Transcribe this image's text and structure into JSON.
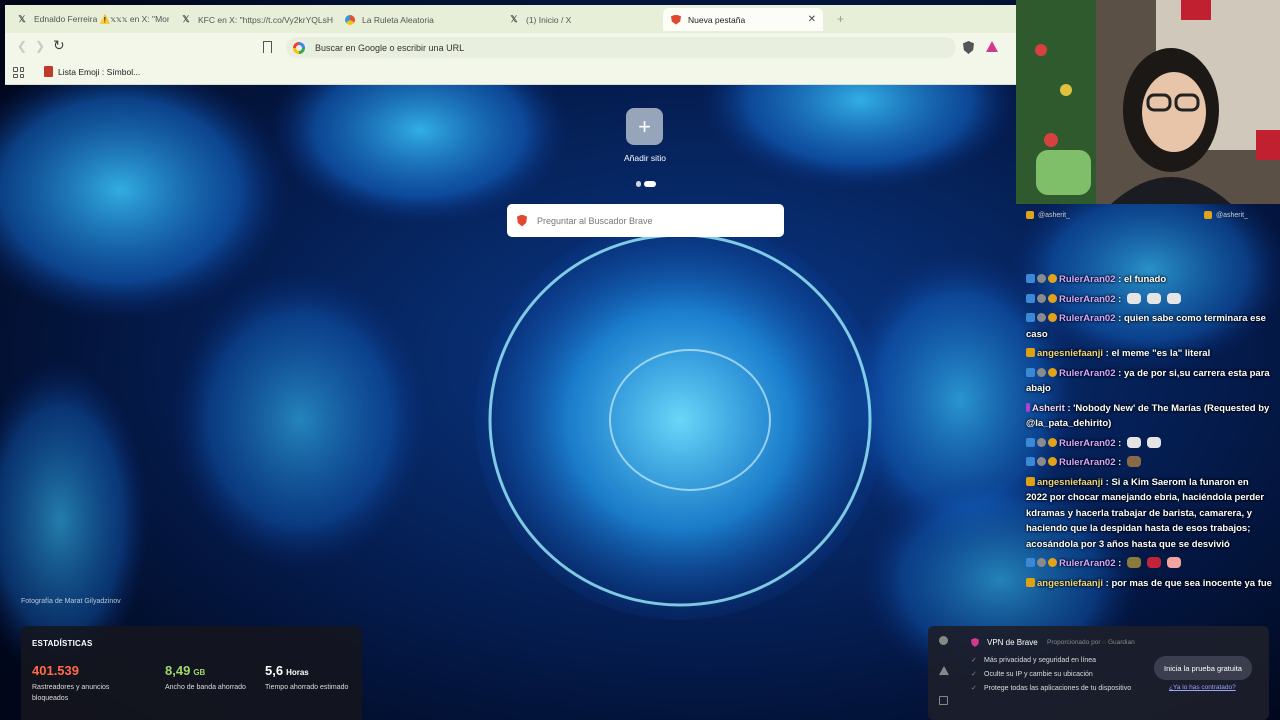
{
  "browser": {
    "tabs": [
      {
        "label": "Ednaldo Ferreira ⚠️𝕩𝕩𝕩 en X: \"Mon",
        "icon": "x-logo-icon",
        "active": false
      },
      {
        "label": "KFC en X: \"https://t.co/Vy2krYQLsH\"",
        "icon": "x-logo-icon",
        "active": false
      },
      {
        "label": "La Ruleta Aleatoria",
        "icon": "ruleta-icon",
        "active": false
      },
      {
        "label": "(1) Inicio / X",
        "icon": "x-logo-icon",
        "active": false
      },
      {
        "label": "Nueva pestaña",
        "icon": "brave-icon",
        "active": true
      }
    ],
    "close_glyph": "✕",
    "new_tab_glyph": "+",
    "back_glyph": "❮",
    "forward_glyph": "❯",
    "reload_glyph": "↻",
    "omnibox_placeholder": "Buscar en Google o escribir una URL",
    "bookmarks": [
      {
        "label": "Lista Emoji : Símbol..."
      }
    ]
  },
  "newtab": {
    "add_site_glyph": "+",
    "add_site_label": "Añadir sitio",
    "search_placeholder": "Preguntar al Buscador Brave",
    "photo_credit": "Fotografía de Marat Gilyadzinov",
    "stats": {
      "title": "ESTADÍSTICAS",
      "items": [
        {
          "value": "401.539",
          "unit": "",
          "desc": "Rastreadores y anuncios bloqueados",
          "color": "#ff6b4a"
        },
        {
          "value": "8,49",
          "unit": "GB",
          "desc": "Ancho de banda ahorrado",
          "color": "#a0d66a"
        },
        {
          "value": "5,6",
          "unit": "Horas",
          "desc": "Tiempo ahorrado estimado",
          "color": "#ffffff"
        }
      ]
    },
    "vpn": {
      "title": "VPN de Brave",
      "provider": "Proporcionado por ◌ Guardian",
      "features": [
        "Más privacidad y seguridad en línea",
        "Oculte su IP y cambie su ubicación",
        "Protege todas las aplicaciones de tu dispositivo"
      ],
      "check_glyph": "✓",
      "cta": "Inicia la prueba gratuita",
      "owned_link": "¿Ya lo has contratado?"
    }
  },
  "stream": {
    "handles": {
      "instagram": "@asherit_",
      "twitter": "@asherit_"
    },
    "chat": [
      {
        "badges": [
          "prime",
          "gear",
          "gold"
        ],
        "user": "RulerAran02",
        "cls": "ruler",
        "text": " : el funado",
        "emotes": []
      },
      {
        "badges": [
          "prime",
          "gear",
          "gold"
        ],
        "user": "RulerAran02",
        "cls": "ruler",
        "text": " : ",
        "emotes": [
          "white",
          "white",
          "white"
        ]
      },
      {
        "badges": [
          "prime",
          "gear",
          "gold"
        ],
        "user": "RulerAran02",
        "cls": "ruler",
        "text": " : quien sabe como terminara ese caso",
        "emotes": []
      },
      {
        "badges": [
          "crown"
        ],
        "user": "angesniefaanji",
        "cls": "ange",
        "text": " : el meme \"es la\" literal",
        "emotes": []
      },
      {
        "badges": [
          "prime",
          "gear",
          "gold"
        ],
        "user": "RulerAran02",
        "cls": "ruler",
        "text": " : ya de por si,su carrera esta para abajo",
        "emotes": []
      },
      {
        "badges": [
          "purple"
        ],
        "user": "Asherit",
        "cls": "ash",
        "text": " : 'Nobody New' de The Marías (Requested by @la_pata_dehirito)",
        "emotes": []
      },
      {
        "badges": [
          "prime",
          "gear",
          "gold"
        ],
        "user": "RulerAran02",
        "cls": "ruler",
        "text": " : ",
        "emotes": [
          "white",
          "white"
        ]
      },
      {
        "badges": [
          "prime",
          "gear",
          "gold"
        ],
        "user": "RulerAran02",
        "cls": "ruler",
        "text": " : ",
        "emotes": [
          "brown"
        ]
      },
      {
        "badges": [
          "crown"
        ],
        "user": "angesniefaanji",
        "cls": "ange",
        "text": " : Si a Kim Saerom la funaron en 2022 por chocar manejando ebria, haciéndola perder kdramas y hacerla trabajar de barista, camarera, y haciendo que la despidan hasta de esos trabajos; acosándola por 3 años hasta que se desvivió",
        "emotes": []
      },
      {
        "badges": [
          "prime",
          "gear",
          "gold"
        ],
        "user": "RulerAran02",
        "cls": "ruler",
        "text": " : ",
        "emotes": [
          "car",
          "red",
          "pink"
        ]
      },
      {
        "badges": [
          "crown"
        ],
        "user": "angesniefaanji",
        "cls": "ange",
        "text": " : por mas de que sea inocente ya fue",
        "emotes": []
      }
    ]
  }
}
